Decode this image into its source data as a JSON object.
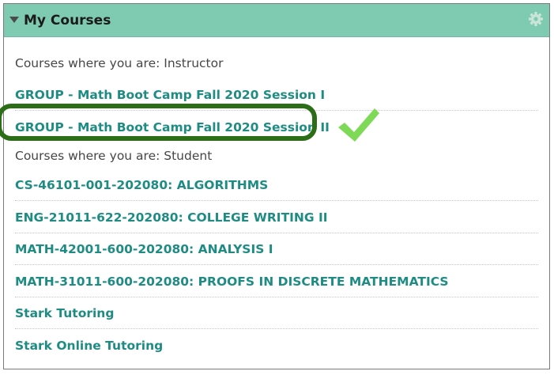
{
  "block": {
    "title": "My Courses",
    "collapse_icon": "triangle-down-icon",
    "settings_icon": "gear-icon"
  },
  "sections": {
    "instructor_label": "Courses where you are: Instructor",
    "student_label": "Courses where you are: Student"
  },
  "instructor_courses": [
    "GROUP - Math Boot Camp Fall 2020 Session I",
    "GROUP - Math Boot Camp Fall 2020 Session II"
  ],
  "student_courses": [
    "CS-46101-001-202080: ALGORITHMS",
    "ENG-21011-622-202080: COLLEGE WRITING II",
    "MATH-42001-600-202080: ANALYSIS I",
    "MATH-31011-600-202080: PROOFS IN DISCRETE MATHEMATICS",
    "Stark Tutoring",
    "Stark Online Tutoring"
  ],
  "annotation": {
    "highlight_color": "#2c6e18",
    "checkmark_icon": "checkmark-icon",
    "checkmark_color": "#7ed957"
  },
  "colors": {
    "header_bg": "#7fcbb1",
    "link": "#1f8c84",
    "label": "#464646"
  }
}
